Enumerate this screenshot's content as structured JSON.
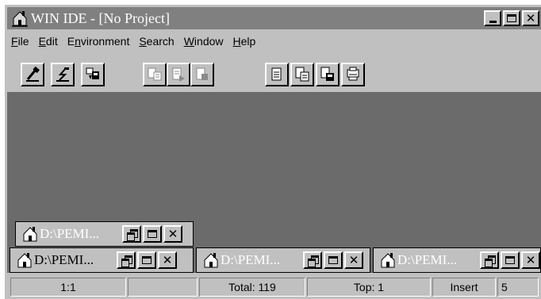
{
  "titlebar": {
    "title": "WIN IDE - [No Project]"
  },
  "menu": [
    {
      "pre": "",
      "u": "F",
      "post": "ile"
    },
    {
      "pre": "",
      "u": "E",
      "post": "dit"
    },
    {
      "pre": "E",
      "u": "n",
      "post": "vironment"
    },
    {
      "pre": "",
      "u": "S",
      "post": "earch"
    },
    {
      "pre": "",
      "u": "W",
      "post": "indow"
    },
    {
      "pre": "",
      "u": "H",
      "post": "elp"
    }
  ],
  "toolbar": {
    "buttons": [
      "compile-icon",
      "run-icon",
      "download-icon",
      "debug-icon",
      "step-icon",
      "stop-icon",
      "new-file-icon",
      "open-file-icon",
      "save-file-icon",
      "print-icon"
    ]
  },
  "windows": [
    {
      "title": "D:\\PEMI..."
    },
    {
      "title": "D:\\PEMI..."
    },
    {
      "title": "D:\\PEMI..."
    },
    {
      "title": "D:\\PEMI..."
    }
  ],
  "status": {
    "position": "1:1",
    "total": "Total: 119",
    "top": "Top: 1",
    "mode": "Insert",
    "value": "5"
  }
}
